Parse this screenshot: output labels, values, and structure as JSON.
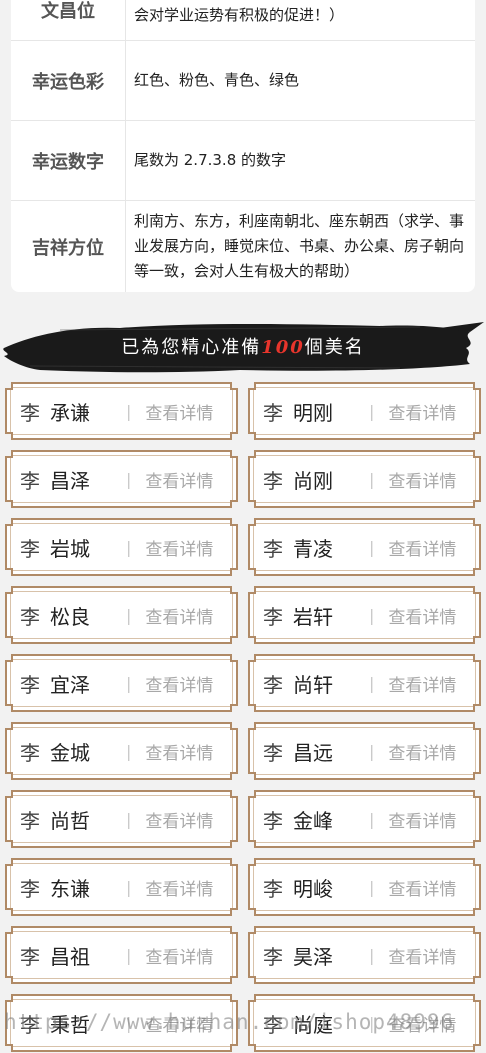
{
  "info_table": [
    {
      "label": "文昌位",
      "value": "会对学业运势有积极的促进！）"
    },
    {
      "label": "幸运色彩",
      "value": "红色、粉色、青色、绿色"
    },
    {
      "label": "幸运数字",
      "value": "尾数为 2.7.3.8 的数字"
    },
    {
      "label": "吉祥方位",
      "value": "利南方、东方，利座南朝北、座东朝西（求学、事业发展方向，睡觉床位、书桌、办公桌、房子朝向等一致，会对人生有极大的帮助）"
    }
  ],
  "banner": {
    "prefix": "已為您精心准備",
    "count": "100",
    "suffix": "個美名"
  },
  "surname": "李",
  "detail_label": "查看详情",
  "separator": "|",
  "names": [
    "承谦",
    "明刚",
    "昌泽",
    "尚刚",
    "岩城",
    "青凌",
    "松良",
    "岩轩",
    "宜泽",
    "尚轩",
    "金城",
    "昌远",
    "尚哲",
    "金峰",
    "东谦",
    "明峻",
    "昌祖",
    "昊泽",
    "秉哲",
    "尚庭"
  ],
  "watermark": "https://www.huzhan.com/ishop48996",
  "colors": {
    "card_border": "#b08a66",
    "banner_brush": "#1a1a1a",
    "banner_number": "#e8352c"
  }
}
